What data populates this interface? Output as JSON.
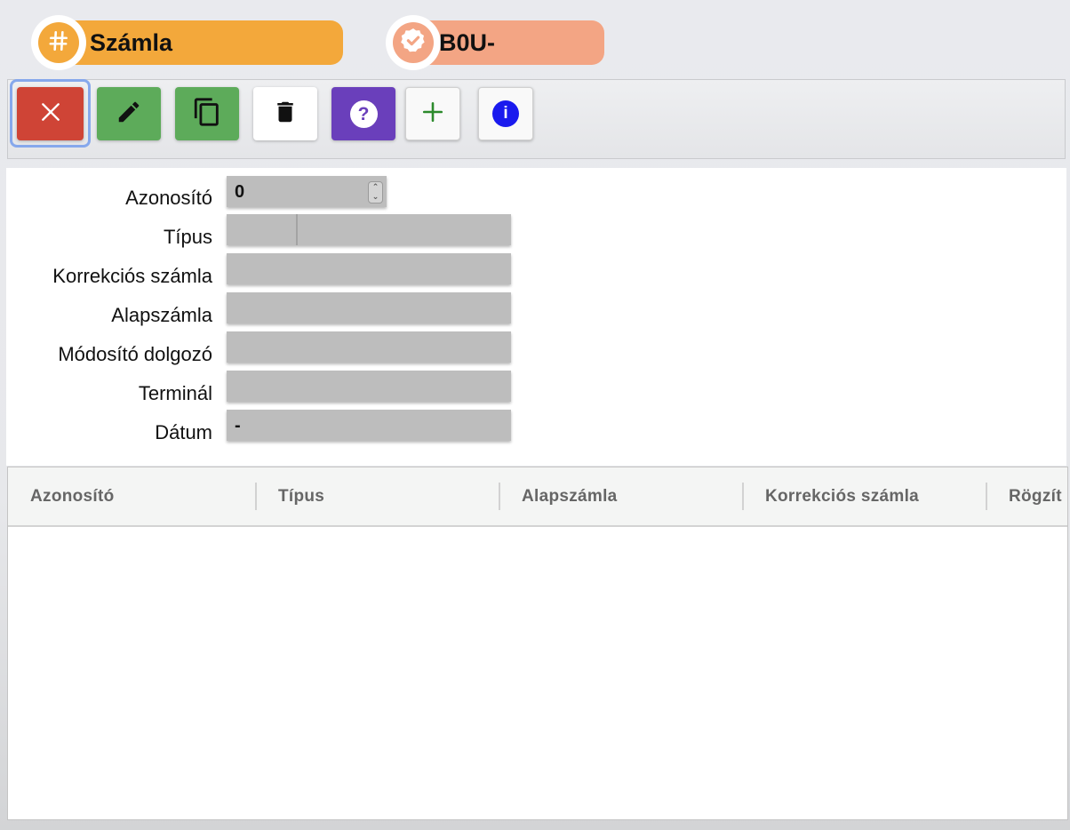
{
  "header": {
    "title": "Számla",
    "title_icon": "hash-icon",
    "code": "B0U-",
    "code_icon": "verified-badge-icon"
  },
  "toolbar": {
    "buttons": [
      {
        "name": "close",
        "icon": "close-icon",
        "color": "#cf4436"
      },
      {
        "name": "edit",
        "icon": "pencil-icon",
        "color": "#5dab5a"
      },
      {
        "name": "copy",
        "icon": "copy-icon",
        "color": "#5dab5a"
      },
      {
        "name": "delete",
        "icon": "trash-icon",
        "color": "#ffffff"
      },
      {
        "name": "help",
        "icon": "help-icon",
        "color": "#6a3fbb"
      },
      {
        "name": "add",
        "icon": "plus-icon",
        "color": "#2c8a2c"
      },
      {
        "name": "info",
        "icon": "info-icon",
        "color": "#1a1aee"
      }
    ],
    "help_glyph": "?",
    "info_glyph": "i"
  },
  "form": {
    "azonosito_label": "Azonosító",
    "azonosito_value": "0",
    "tipus_label": "Típus",
    "korrekcios_label": "Korrekciós számla",
    "alapszamla_label": "Alapszámla",
    "modosito_label": "Módosító dolgozó",
    "terminal_label": "Terminál",
    "datum_label": "Dátum",
    "datum_value": "-"
  },
  "table": {
    "columns": [
      "Azonosító",
      "Típus",
      "Alapszámla",
      "Korrekciós számla",
      "Rögzít"
    ],
    "rows": []
  }
}
